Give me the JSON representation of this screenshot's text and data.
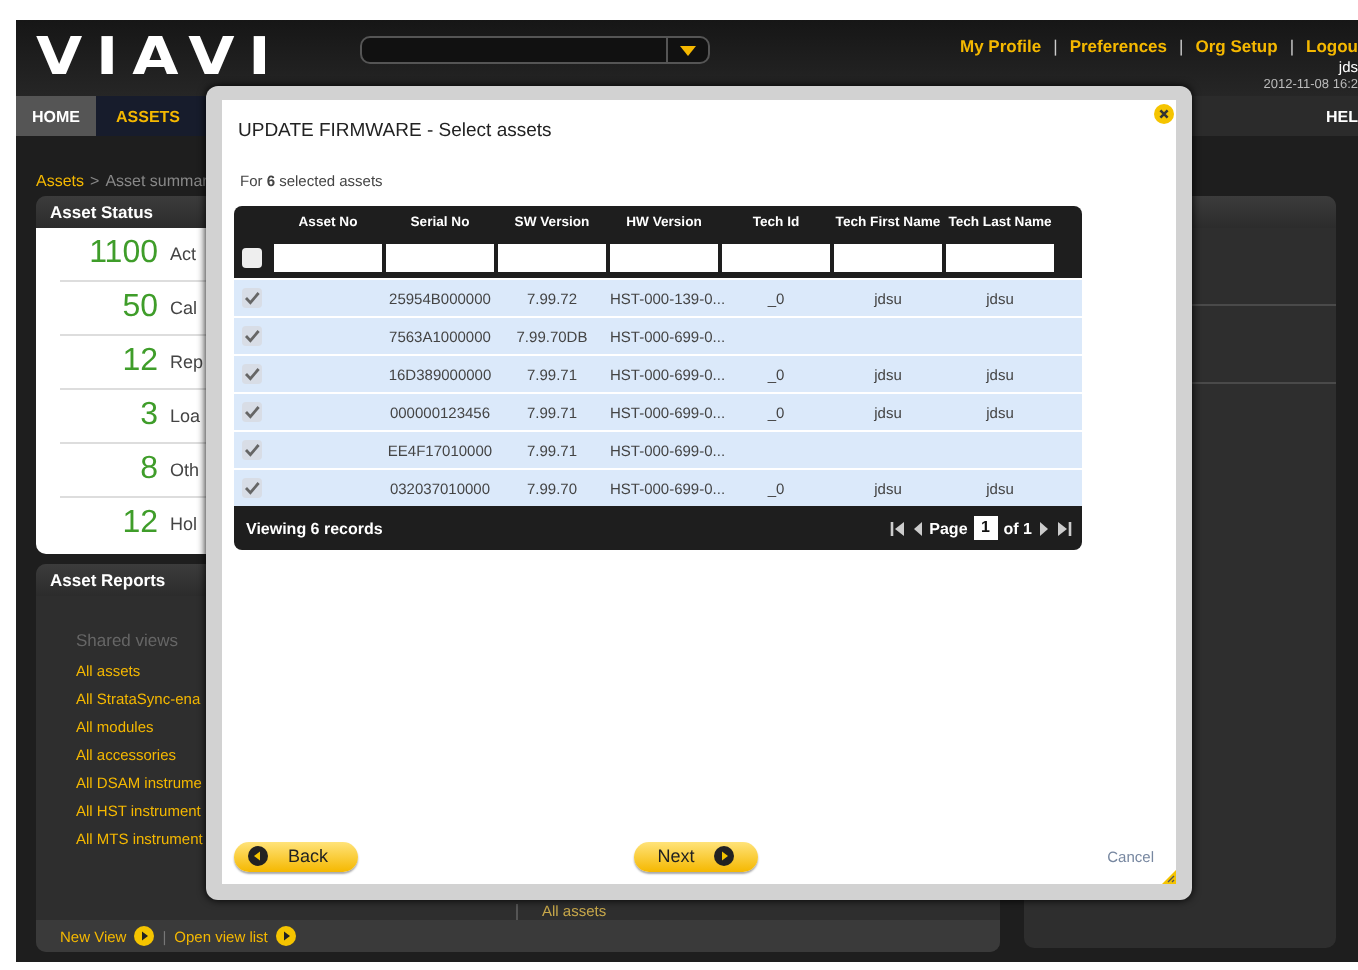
{
  "header": {
    "logo": "VIAVI",
    "user_links": [
      "My Profile",
      "Preferences",
      "Org Setup",
      "Logou"
    ],
    "link_separator": "|",
    "user": "jds",
    "timestamp": "2012-11-08 16:2"
  },
  "nav": [
    {
      "label": "HOME",
      "selected": false
    },
    {
      "label": "ASSETS",
      "selected": true
    }
  ],
  "nav_right": "HEL",
  "breadcrumb": {
    "items": [
      "Assets",
      "Asset summar"
    ],
    "separator": ">"
  },
  "asset_status": {
    "title": "Asset Status",
    "rows": [
      {
        "count": "1100",
        "label": "Act"
      },
      {
        "count": "50",
        "label": "Cal"
      },
      {
        "count": "12",
        "label": "Rep"
      },
      {
        "count": "3",
        "label": "Loa"
      },
      {
        "count": "8",
        "label": "Oth"
      },
      {
        "count": "12",
        "label": "Hol"
      }
    ]
  },
  "asset_reports": {
    "title": "Asset Reports",
    "section": "Shared views",
    "views": [
      "All assets",
      "All StrataSync-ena",
      "All modules",
      "All accessories",
      "All DSAM instrume",
      "All HST instrument",
      "All MTS instrument"
    ],
    "center_link": "All assets",
    "footer_links": [
      "New View",
      "Open view list"
    ],
    "footer_separator": "|"
  },
  "modal": {
    "title": "UPDATE FIRMWARE - Select assets",
    "intro": "For **6** selected assets",
    "table": {
      "select_all_checked": false,
      "columns": [
        "Asset No",
        "Serial No",
        "SW Version",
        "HW Version",
        "Tech Id",
        "Tech First Name",
        "Tech Last Name"
      ],
      "rows": [
        {
          "checked": true,
          "cells": [
            null,
            "25954B000000",
            "7.99.72",
            "HST-000-139-0...",
            "_0",
            "jdsu",
            "jdsu"
          ]
        },
        {
          "checked": true,
          "cells": [
            null,
            "7563A1000000",
            "7.99.70DB",
            "HST-000-699-0...",
            null,
            null,
            null
          ]
        },
        {
          "checked": true,
          "cells": [
            null,
            "16D389000000",
            "7.99.71",
            "HST-000-699-0...",
            "_0",
            "jdsu",
            "jdsu"
          ]
        },
        {
          "checked": true,
          "cells": [
            null,
            "000000123456",
            "7.99.71",
            "HST-000-699-0...",
            "_0",
            "jdsu",
            "jdsu"
          ]
        },
        {
          "checked": true,
          "cells": [
            null,
            "EE4F17010000",
            "7.99.71",
            "HST-000-699-0...",
            null,
            null,
            null
          ]
        },
        {
          "checked": true,
          "cells": [
            null,
            "032037010000",
            "7.99.70",
            "HST-000-699-0...",
            "_0",
            "jdsu",
            "jdsu"
          ]
        }
      ],
      "footer": "Viewing 6 records",
      "pager": {
        "label": "Page",
        "page": "1",
        "of": "of 1"
      }
    },
    "buttons": {
      "back": "Back",
      "next": "Next",
      "cancel": "Cancel"
    }
  }
}
